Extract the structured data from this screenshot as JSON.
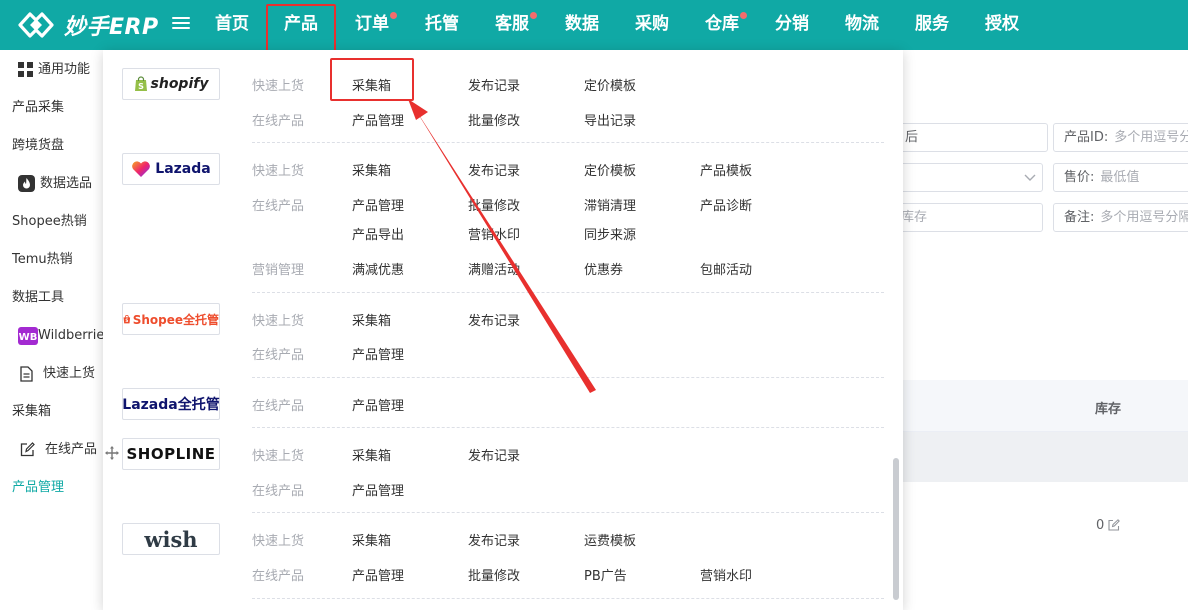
{
  "app": {
    "name": "妙手ERP",
    "brand_color": "#10a9a5",
    "accent_red": "#e8302e"
  },
  "topnav": [
    {
      "label": "首页",
      "dot": false
    },
    {
      "label": "产品",
      "dot": false,
      "active": true
    },
    {
      "label": "订单",
      "dot": true
    },
    {
      "label": "托管",
      "dot": false
    },
    {
      "label": "客服",
      "dot": true
    },
    {
      "label": "数据",
      "dot": false
    },
    {
      "label": "采购",
      "dot": false
    },
    {
      "label": "仓库",
      "dot": true
    },
    {
      "label": "分销",
      "dot": false
    },
    {
      "label": "物流",
      "dot": false
    },
    {
      "label": "服务",
      "dot": false
    },
    {
      "label": "授权",
      "dot": false
    }
  ],
  "sidebar": {
    "items": [
      {
        "label": "通用功能",
        "icon": "grid-icon"
      },
      {
        "label": "产品采集"
      },
      {
        "label": "跨境货盘"
      },
      {
        "label": "数据选品",
        "icon": "fire-icon"
      },
      {
        "label": "Shopee热销"
      },
      {
        "label": "Temu热销"
      },
      {
        "label": "数据工具"
      },
      {
        "label": "Wildberries",
        "icon": "wb-icon"
      },
      {
        "label": "快速上货",
        "icon": "document-icon"
      },
      {
        "label": "采集箱"
      },
      {
        "label": "在线产品",
        "icon": "edit-icon"
      },
      {
        "label": "产品管理",
        "active": true
      }
    ]
  },
  "filters": {
    "partial_1": "后",
    "product_id_label": "产品ID:",
    "product_id_placeholder": "多个用逗号分",
    "price_label": "售价:",
    "price_placeholder": "最低值",
    "partial_2": "库存",
    "note_label": "备注:",
    "note_placeholder": "多个用逗号分隔"
  },
  "table": {
    "stock_header": "库存",
    "stock_value": "0"
  },
  "dropdown": {
    "sections": [
      {
        "brand": "shopify",
        "rows": [
          {
            "category": "快速上货",
            "links": [
              "采集箱",
              "发布记录",
              "定价模板"
            ]
          },
          {
            "category": "在线产品",
            "links": [
              "产品管理",
              "批量修改",
              "导出记录"
            ]
          }
        ]
      },
      {
        "brand": "Lazada",
        "rows": [
          {
            "category": "快速上货",
            "links": [
              "采集箱",
              "发布记录",
              "定价模板",
              "产品模板"
            ]
          },
          {
            "category": "在线产品",
            "links": [
              "产品管理",
              "批量修改",
              "滞销清理",
              "产品诊断"
            ]
          },
          {
            "category": "",
            "links": [
              "产品导出",
              "营销水印",
              "同步来源"
            ]
          },
          {
            "category": "营销管理",
            "links": [
              "满减优惠",
              "满赠活动",
              "优惠券",
              "包邮活动"
            ]
          }
        ]
      },
      {
        "brand": "Shopee全托管",
        "rows": [
          {
            "category": "快速上货",
            "links": [
              "采集箱",
              "发布记录"
            ]
          },
          {
            "category": "在线产品",
            "links": [
              "产品管理"
            ]
          }
        ]
      },
      {
        "brand": "Lazada全托管",
        "rows": [
          {
            "category": "在线产品",
            "links": [
              "产品管理"
            ]
          }
        ]
      },
      {
        "brand": "SHOPLINE",
        "rows": [
          {
            "category": "快速上货",
            "links": [
              "采集箱",
              "发布记录"
            ]
          },
          {
            "category": "在线产品",
            "links": [
              "产品管理"
            ]
          }
        ]
      },
      {
        "brand": "wish",
        "rows": [
          {
            "category": "快速上货",
            "links": [
              "采集箱",
              "发布记录",
              "运费模板"
            ]
          },
          {
            "category": "在线产品",
            "links": [
              "产品管理",
              "批量修改",
              "PB广告",
              "营销水印"
            ]
          }
        ]
      }
    ]
  }
}
